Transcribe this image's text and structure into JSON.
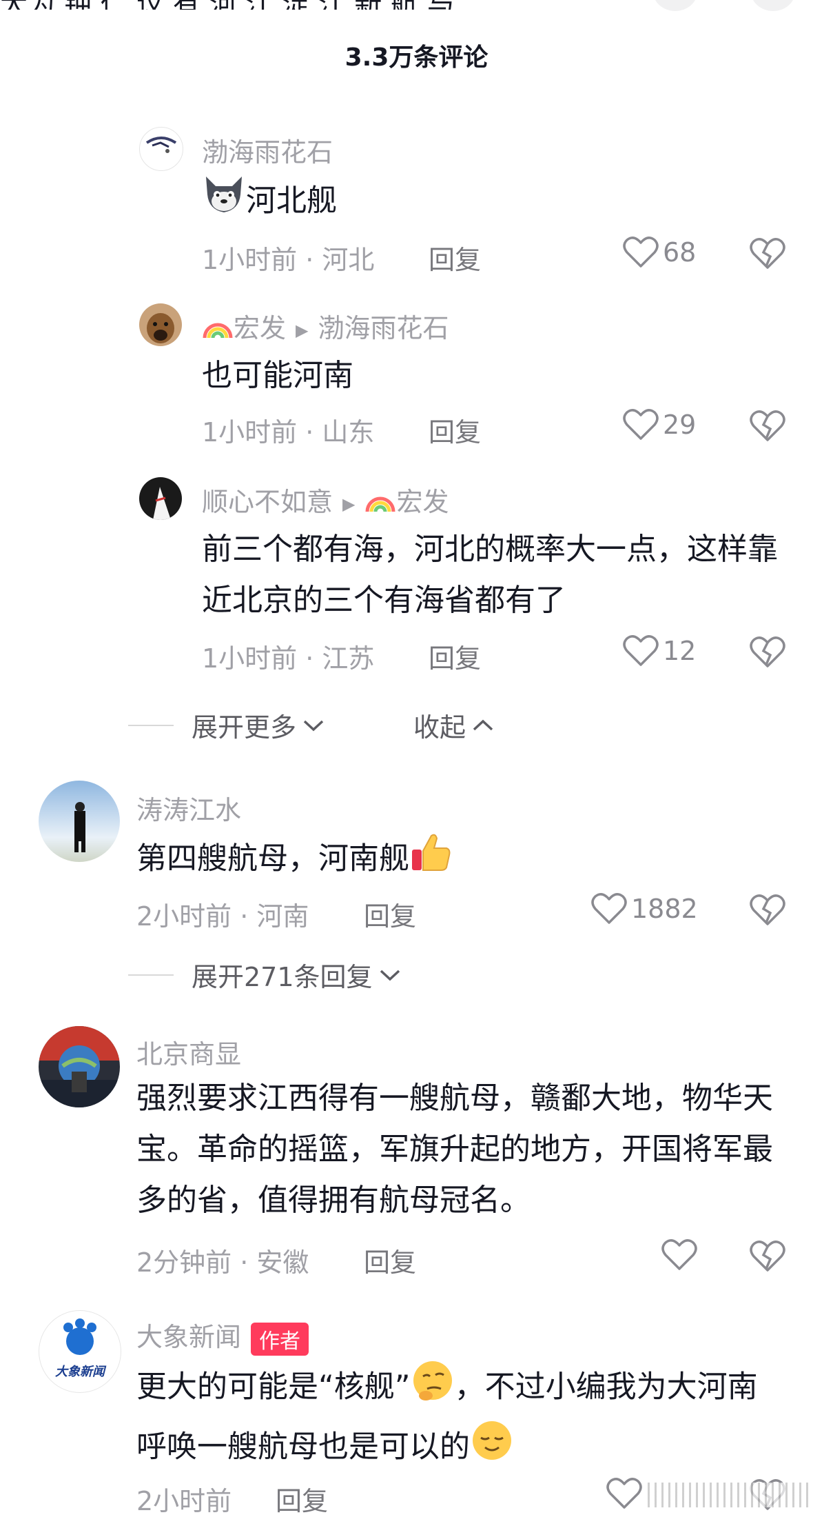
{
  "top_partial_text": "大为   钟 仁   议   有    河   江   淀   江   新 航   与",
  "header": {
    "title": "3.3万条评论"
  },
  "comments": [
    {
      "user": "渤海雨花石",
      "text": "河北舰",
      "time": "1小时前 · 河北",
      "reply": "回复",
      "likes": "68"
    },
    {
      "user": "宏发",
      "reply_to": "渤海雨花石",
      "text": "也可能河南",
      "time": "1小时前 · 山东",
      "reply": "回复",
      "likes": "29"
    },
    {
      "user": "顺心不如意",
      "reply_to": "宏发",
      "text": "前三个都有海，河北的概率大一点，这样靠近北京的三个有海省都有了",
      "time": "1小时前 · 江苏",
      "reply": "回复",
      "likes": "12"
    },
    {
      "user": "涛涛江水",
      "text": "第四艘航母，河南舰",
      "time": "2小时前 · 河南",
      "reply": "回复",
      "likes": "1882"
    },
    {
      "user": "北京商显",
      "text": "强烈要求江西得有一艘航母，赣鄱大地，物华天宝。革命的摇篮，军旗升起的地方，开国将军最多的省，值得拥有航母冠名。",
      "time": "2分钟前 · 安徽",
      "reply": "回复",
      "likes": ""
    },
    {
      "user": "大象新闻",
      "badge": "作者",
      "text_a": "更大的可能是“核舰”",
      "text_b": "，不过小编我为大河南呼唤一艘航母也是可以的",
      "time": "2小时前",
      "reply": "回复",
      "likes": ""
    }
  ],
  "expanders": {
    "more": "展开更多",
    "collapse": "收起",
    "replies": "展开271条回复"
  },
  "avatar_texts": {
    "daxiang": "大象新闻"
  },
  "colors": {
    "badge": "#ff3b5c",
    "muted": "#a0a0a6",
    "text": "#161823"
  }
}
